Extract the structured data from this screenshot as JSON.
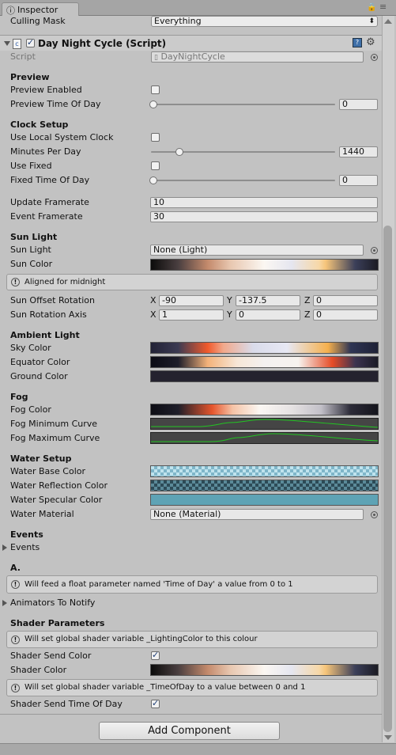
{
  "tab": {
    "title": "Inspector"
  },
  "culling": {
    "label": "Culling Mask",
    "value": "Everything"
  },
  "component": {
    "title": "Day Night Cycle (Script)",
    "script_label": "Script",
    "script_value": "DayNightCycle"
  },
  "preview": {
    "header": "Preview",
    "enabled_label": "Preview Enabled",
    "time_label": "Preview Time Of Day",
    "time_value": "0",
    "time_fraction": 0
  },
  "clock": {
    "header": "Clock Setup",
    "local_label": "Use Local System Clock",
    "minutes_label": "Minutes Per Day",
    "minutes_value": "1440",
    "minutes_fraction": 0.15,
    "fixed_label": "Use Fixed",
    "fixed_time_label": "Fixed Time Of Day",
    "fixed_time_value": "0",
    "fixed_time_fraction": 0,
    "update_label": "Update Framerate",
    "update_value": "10",
    "event_label": "Event Framerate",
    "event_value": "30"
  },
  "sun": {
    "header": "Sun Light",
    "light_label": "Sun Light",
    "light_value": "None (Light)",
    "color_label": "Sun Color",
    "help": "Aligned for midnight",
    "offset_label": "Sun Offset Rotation",
    "offset": {
      "x": "-90",
      "y": "-137.5",
      "z": "0"
    },
    "axis_label": "Sun Rotation Axis",
    "axis": {
      "x": "1",
      "y": "0",
      "z": "0"
    }
  },
  "axes": {
    "x": "X",
    "y": "Y",
    "z": "Z"
  },
  "ambient": {
    "header": "Ambient Light",
    "sky_label": "Sky Color",
    "equator_label": "Equator Color",
    "ground_label": "Ground Color"
  },
  "fog": {
    "header": "Fog",
    "color_label": "Fog Color",
    "min_label": "Fog Minimum Curve",
    "max_label": "Fog Maximum Curve"
  },
  "water": {
    "header": "Water Setup",
    "base_label": "Water Base Color",
    "reflection_label": "Water Reflection Color",
    "specular_label": "Water Specular Color",
    "material_label": "Water Material",
    "material_value": "None (Material)"
  },
  "events": {
    "header": "Events",
    "foldout": "Events"
  },
  "a_section": {
    "header": "A.",
    "help": "Will feed a float parameter named 'Time of Day' a value from 0 to 1",
    "foldout": "Animators To Notify"
  },
  "shader": {
    "header": "Shader Parameters",
    "help1": "Will set global shader variable _LightingColor to this colour",
    "send_color_label": "Shader Send Color",
    "color_label": "Shader Color",
    "help2": "Will set global shader variable _TimeOfDay to a value between 0 and 1",
    "send_time_label": "Shader Send Time Of Day"
  },
  "add_component": "Add Component",
  "colors": {
    "water_specular": "#5ea3b5",
    "curve": "#22c522",
    "accent": "#1e3d76"
  }
}
